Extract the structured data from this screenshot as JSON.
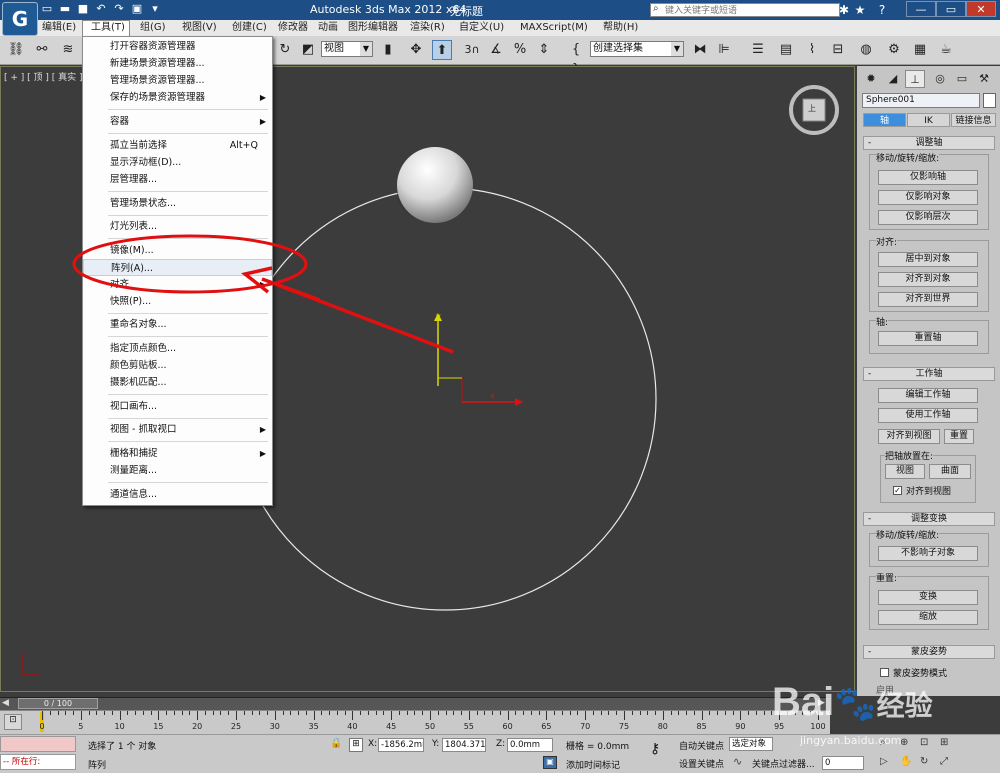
{
  "titlebar": {
    "app_name": "Autodesk 3ds Max  2012 x64",
    "file_name": "无标题",
    "search_placeholder": "键入关键字或短语"
  },
  "menubar": {
    "items": [
      "编辑(E)",
      "工具(T)",
      "组(G)",
      "视图(V)",
      "创建(C)",
      "修改器",
      "动画",
      "图形编辑器",
      "渲染(R)",
      "自定义(U)",
      "MAXScript(M)",
      "帮助(H)"
    ]
  },
  "toolbar": {
    "view_combo": "视图",
    "selection_set_combo": "创建选择集",
    "snap_number": "3",
    "snap_percent": "%"
  },
  "viewport": {
    "label": "[ + ] [ 顶 ] [ 真实 ]",
    "object_name_axis_y": "y",
    "axis_x": "x",
    "viewcube_face": "上"
  },
  "tools_menu": {
    "items": [
      {
        "label": "打开容器资源管理器",
        "shortcut": "",
        "submenu": false
      },
      {
        "label": "新建场景资源管理器...",
        "shortcut": "",
        "submenu": false
      },
      {
        "label": "管理场景资源管理器...",
        "shortcut": "",
        "submenu": false
      },
      {
        "label": "保存的场景资源管理器",
        "shortcut": "",
        "submenu": true
      },
      {
        "label": "容器",
        "shortcut": "",
        "submenu": true
      },
      {
        "label": "孤立当前选择",
        "shortcut": "Alt+Q",
        "submenu": false
      },
      {
        "label": "显示浮动框(D)...",
        "shortcut": "",
        "submenu": false
      },
      {
        "label": "层管理器...",
        "shortcut": "",
        "submenu": false
      },
      {
        "label": "管理场景状态...",
        "shortcut": "",
        "submenu": false
      },
      {
        "label": "灯光列表...",
        "shortcut": "",
        "submenu": false
      },
      {
        "label": "镜像(M)...",
        "shortcut": "",
        "submenu": false
      },
      {
        "label": "阵列(A)...",
        "shortcut": "",
        "submenu": false
      },
      {
        "label": "对齐",
        "shortcut": "",
        "submenu": true
      },
      {
        "label": "快照(P)...",
        "shortcut": "",
        "submenu": false
      },
      {
        "label": "重命名对象...",
        "shortcut": "",
        "submenu": false
      },
      {
        "label": "指定顶点颜色...",
        "shortcut": "",
        "submenu": false
      },
      {
        "label": "颜色剪贴板...",
        "shortcut": "",
        "submenu": false
      },
      {
        "label": "摄影机匹配...",
        "shortcut": "",
        "submenu": false
      },
      {
        "label": "视口画布...",
        "shortcut": "",
        "submenu": false
      },
      {
        "label": "视图 - 抓取视口",
        "shortcut": "",
        "submenu": true
      },
      {
        "label": "栅格和捕捉",
        "shortcut": "",
        "submenu": true
      },
      {
        "label": "测量距离...",
        "shortcut": "",
        "submenu": false
      },
      {
        "label": "通道信息...",
        "shortcut": "",
        "submenu": false
      }
    ]
  },
  "command_panel": {
    "object_name": "Sphere001",
    "subtabs": [
      "轴",
      "IK",
      "链接信息"
    ],
    "adjust_pivot": {
      "title": "调整轴",
      "move_group": "移动/旋转/缩放:",
      "affect_pivot_only": "仅影响轴",
      "affect_object_only": "仅影响对象",
      "affect_hierarchy_only": "仅影响层次",
      "align_group": "对齐:",
      "center_to_object": "居中到对象",
      "align_to_object": "对齐到对象",
      "align_to_world": "对齐到世界",
      "pivot_group": "轴:",
      "reset_pivot": "重置轴"
    },
    "working_pivot": {
      "title": "工作轴",
      "edit_working_pivot": "编辑工作轴",
      "use_working_pivot": "使用工作轴",
      "align_to_view": "对齐到视图",
      "reset": "重置",
      "place_pivot_to": "把轴放置在:",
      "view": "视图",
      "surface": "曲面",
      "align_to_view_check": "对齐到视图"
    },
    "adjust_transform": {
      "title": "调整变换",
      "move_group": "移动/旋转/缩放:",
      "dont_affect_children": "不影响子对象",
      "reset_group": "重置:",
      "transform": "变换",
      "scale": "缩放"
    },
    "skin_pose": {
      "title": "蒙皮姿势",
      "mode_check": "蒙皮姿势模式",
      "enabled": "启用"
    }
  },
  "timeline": {
    "position": "0 / 100",
    "ticks": [
      "0",
      "5",
      "10",
      "15",
      "20",
      "25",
      "30",
      "35",
      "40",
      "45",
      "50",
      "55",
      "60",
      "65",
      "70",
      "75",
      "80",
      "85",
      "90",
      "95",
      "100"
    ]
  },
  "statusbar": {
    "maxscript_hint": "所在行:",
    "selection_status": "选择了 1 个 对象",
    "prompt": "阵列",
    "x_label": "X:",
    "x_value": "-1856.2mm",
    "y_label": "Y:",
    "y_value": "1804.371m",
    "z_label": "Z:",
    "z_value": "0.0mm",
    "grid_label": "栅格 = 0.0mm",
    "add_time_tag": "添加时间标记",
    "auto_key": "自动关键点",
    "selected_object": "选定对象",
    "set_key": "设置关键点",
    "key_filters": "关键点过滤器...",
    "frame": "0"
  },
  "watermark": {
    "brand": "Bai",
    "brand_suffix": "经验",
    "site": "jingyan.baidu.com"
  },
  "colors": {
    "titlebar": "#1d4f86",
    "viewport_bg": "#3c3c3c",
    "annotation_red": "#e01010",
    "panel_bg": "#c5c5c5"
  }
}
